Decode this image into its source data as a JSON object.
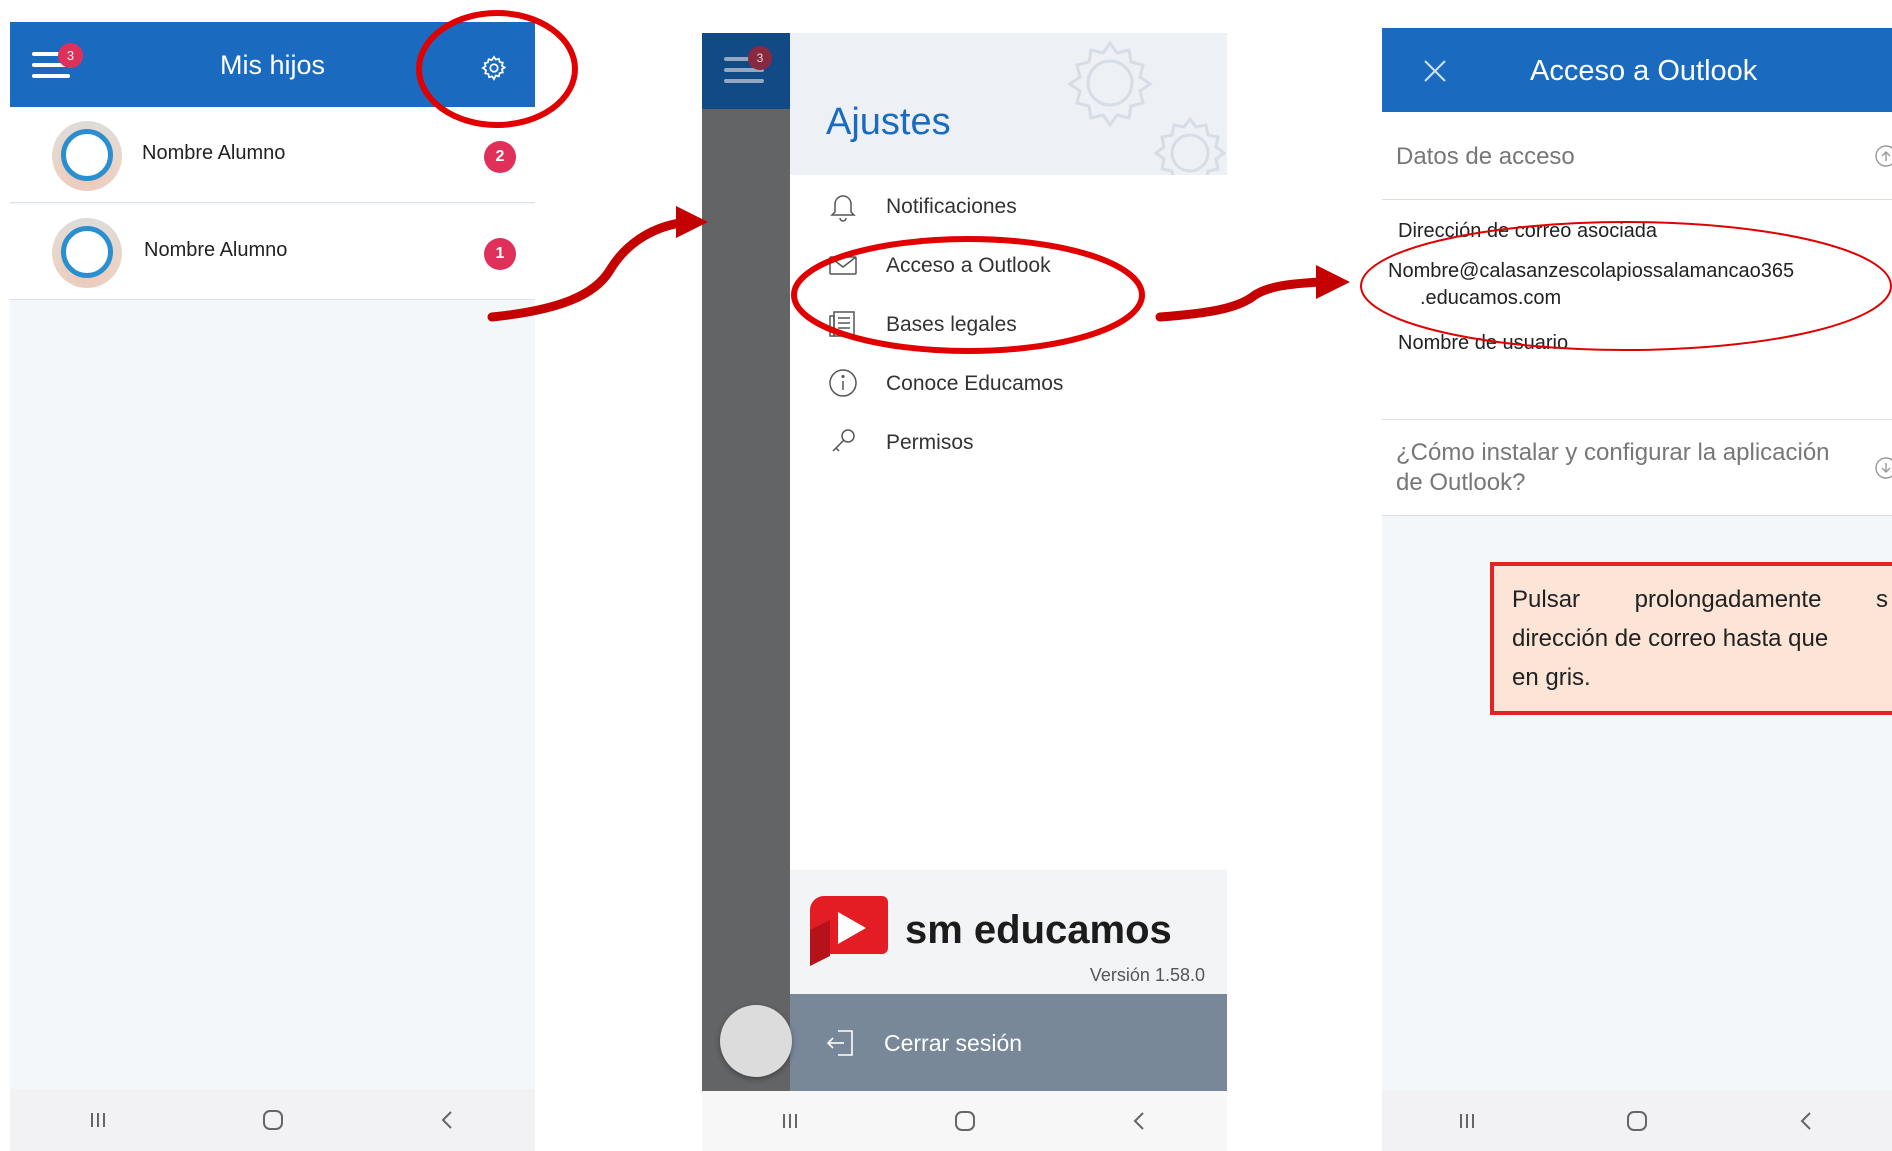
{
  "screen1": {
    "title": "Mis hijos",
    "menu_badge": "3",
    "children": [
      {
        "name": "Nombre Alumno",
        "badge": "2"
      },
      {
        "name": "Nombre Alumno",
        "badge": "1"
      }
    ]
  },
  "screen2": {
    "menu_badge": "3",
    "drawer_title": "Ajustes",
    "menu_items": [
      {
        "label": "Notificaciones",
        "icon": "bell-icon"
      },
      {
        "label": "Acceso a Outlook",
        "icon": "mail-icon"
      },
      {
        "label": "Bases legales",
        "icon": "document-icon"
      },
      {
        "label": "Conoce Educamos",
        "icon": "info-icon"
      },
      {
        "label": "Permisos",
        "icon": "key-icon"
      }
    ],
    "brand_name": "sm educamos",
    "version": "Versión 1.58.0",
    "logout_label": "Cerrar sesión"
  },
  "screen3": {
    "title": "Acceso a Outlook",
    "section_access": "Datos de acceso",
    "email_label": "Dirección de correo asociada",
    "email_line1": "Nombre@calasanzescolapiossalamancao365",
    "email_line2": ".educamos.com",
    "username_label": "Nombre de usuario",
    "section_help_line1": "¿Cómo instalar y configurar la aplicación",
    "section_help_line2": "de Outlook?",
    "note_line1_a": "Pulsar",
    "note_line1_b": "prolongadamente",
    "note_line1_c": "s",
    "note_line2": "dirección de correo hasta que",
    "note_line3": "en gris."
  },
  "colors": {
    "header_blue": "#1a6bbf",
    "badge_pink": "#e0305a",
    "annotation_red": "#e00000",
    "note_bg": "#fce4d6"
  }
}
